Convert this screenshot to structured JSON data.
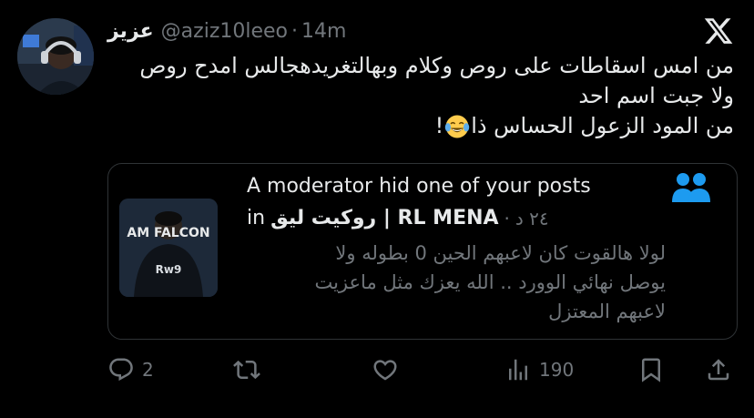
{
  "tweet": {
    "display_name": "عزيز",
    "handle": "@aziz10leeo",
    "separator": "·",
    "time": "14m",
    "text_lines": [
      "من امس اسقاطات على روص وكلام وبهالتغريدهجالس امدح روص",
      "ولا جبت اسم احد",
      "من المود الزعول الحساس ذا"
    ],
    "text_line3_suffix": "!",
    "emoji_name": "face-with-tears-of-joy"
  },
  "card": {
    "title": "A moderator hid one of your posts",
    "sub_prefix": "in",
    "community": "روكيت ليق | RL MENA",
    "separator": "·",
    "date": "٢٤ د",
    "body_lines": [
      "لولا هالقوت كان لاعبهم الحين 0 بطوله ولا",
      "يوصل نهائي الوورد .. الله يعزك مثل ماعزيت",
      "لاعبهم المعتزل"
    ],
    "thumb_text_top": "AM FALCON",
    "thumb_jersey": "Rw9",
    "people_icon_color": "#1d9bf0"
  },
  "actions": {
    "reply_count": "2",
    "views_count": "190"
  },
  "colors": {
    "background": "#000000",
    "text_primary": "#e7e9ea",
    "text_secondary": "#71767b",
    "border": "#2f3336",
    "accent": "#1d9bf0"
  }
}
